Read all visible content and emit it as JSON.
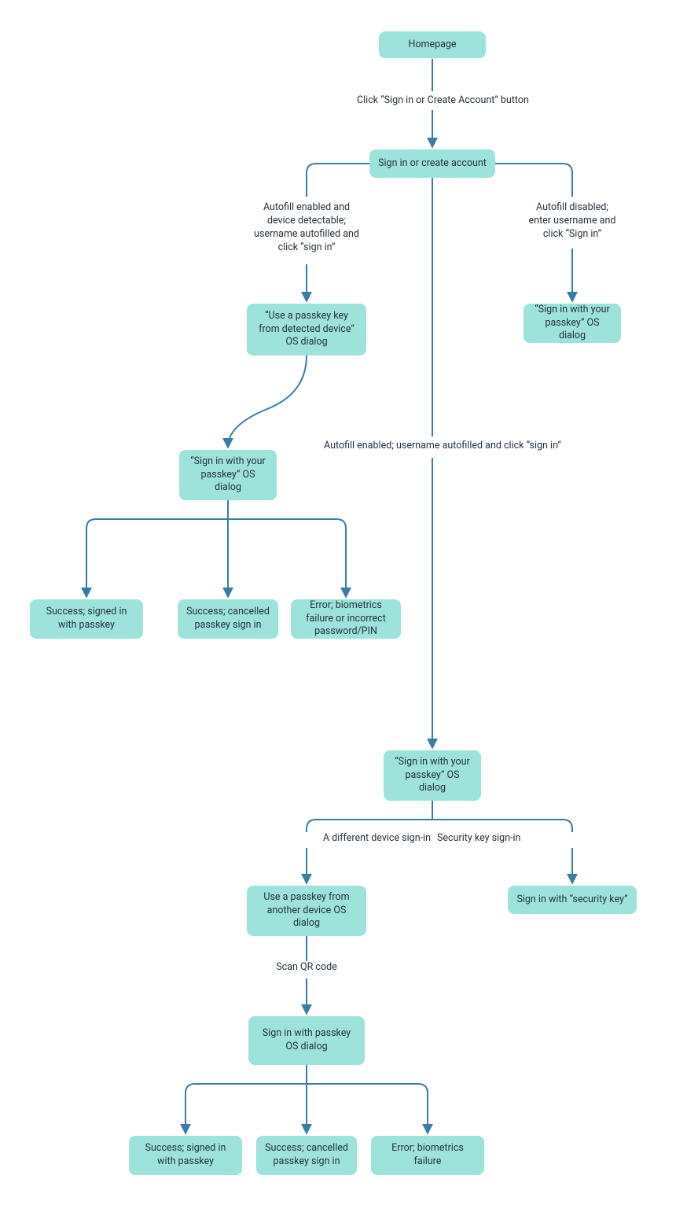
{
  "colors": {
    "node_fill": "#9DE3DC",
    "line": "#3A7CA5",
    "background": "#FFFFFF",
    "text": "#25323F"
  },
  "nodes": {
    "homepage": "Homepage",
    "signin_create": "Sign in or create account",
    "autofill_detected_dialog": "“Use a passkey key from detected device” OS dialog",
    "signin_passkey_dialog_right": "“Sign in with your passkey” OS dialog",
    "signin_passkey_dialog_left": "“Sign in with your passkey” OS dialog",
    "success_signed_in_1": "Success; signed in with passkey",
    "success_cancelled_1": "Success; cancelled passkey sign in",
    "error_biometrics_pin": "Error; biometrics failure or incorrect password/PIN",
    "signin_passkey_dialog_mid": "“Sign in with your passkey” OS dialog",
    "another_device_dialog": "Use a passkey from another device OS dialog",
    "security_key": "Sign in with “security key”",
    "signin_passkey_dialog_low": "Sign in with passkey OS dialog",
    "success_signed_in_2": "Success; signed in with passkey",
    "success_cancelled_2": "Success; cancelled passkey sign in",
    "error_biometrics_2": "Error; biometrics failure"
  },
  "edges": {
    "click_signin_button": "Click “Sign in or Create Account” button",
    "autofill_enabled_detectable": "Autofill enabled and device detectable; username autofilled and click “sign in”",
    "autofill_disabled": "Autofill disabled; enter username and click “Sign in”",
    "autofill_enabled": "Autofill enabled; username autofilled and click “sign in”",
    "different_device": "A different device sign-in",
    "security_key_signin": "Security key sign-in",
    "scan_qr": "Scan QR code"
  }
}
